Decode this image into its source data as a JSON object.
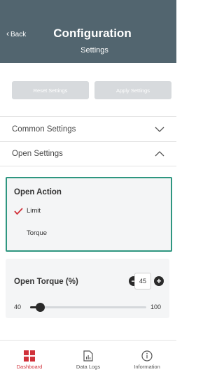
{
  "header": {
    "back_label": "Back",
    "title": "Configuration",
    "subtitle": "Settings"
  },
  "actions": {
    "reset_label": "Reset Settings",
    "apply_label": "Apply Settings"
  },
  "sections": {
    "common_label": "Common Settings",
    "open_label": "Open Settings"
  },
  "open_action": {
    "title": "Open Action",
    "options": [
      {
        "label": "Limit",
        "selected": true
      },
      {
        "label": "Torque",
        "selected": false
      }
    ]
  },
  "open_torque": {
    "title": "Open Torque (%)",
    "value": "45",
    "min": "40",
    "max": "100",
    "slider_value": 45
  },
  "tabs": [
    {
      "label": "Dashboard",
      "active": true
    },
    {
      "label": "Data Logs",
      "active": false
    },
    {
      "label": "Information",
      "active": false
    }
  ],
  "colors": {
    "header_bg": "#52656f",
    "accent_teal": "#2e9680",
    "active_red": "#d0313a",
    "check_red": "#d0313a"
  }
}
